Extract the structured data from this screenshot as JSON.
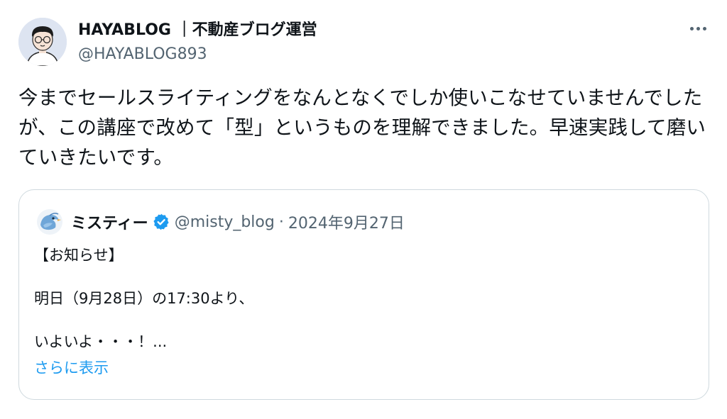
{
  "author": {
    "display_name": "HAYABLOG ｜不動産ブログ運営",
    "handle": "@HAYABLOG893"
  },
  "tweet": {
    "text": "今までセールスライティングをなんとなくでしか使いこなせていませんでしたが、この講座で改めて「型」というものを理解できました。早速実践して磨いていきたいです。"
  },
  "quoted": {
    "display_name": "ミスティー",
    "handle": "@misty_blog",
    "separator": "·",
    "date": "2024年9月27日",
    "lines": [
      "【お知らせ】",
      "明日（9月28日）の17:30より、",
      "いよいよ・・・！..."
    ],
    "show_more": "さらに表示"
  },
  "colors": {
    "accent": "#1d9bf0",
    "muted": "#536471",
    "border": "#cfd9de"
  },
  "icons": [
    "avatar",
    "more-icon",
    "verified-icon"
  ]
}
